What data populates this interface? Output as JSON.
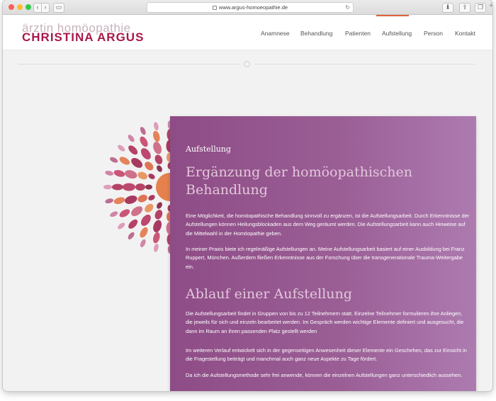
{
  "browser": {
    "url": "www.argus-homoeopathie.de",
    "new_tab_label": "+"
  },
  "logo": {
    "line1": "ärztin homöopathie",
    "line2": "CHRISTINA ARGUS",
    "colors": {
      "line1": "#c7b3bd",
      "line2": "#a8184b"
    }
  },
  "nav": {
    "items": [
      "Anamnese",
      "Behandlung",
      "Patienten",
      "Aufstellung",
      "Person",
      "Kontakt"
    ],
    "active": "Aufstellung",
    "active_color": "#e0623a"
  },
  "content": {
    "label": "Aufstellung",
    "title": "Ergänzung der homöopathischen Behandlung",
    "paragraph1": "Eine Möglichkeit, die homöopathische Behandlung sinnvoll zu ergänzen, ist die Aufstellungsarbeit. Durch Erkenntnisse der Aufstellungen können Heilungsblockaden aus dem Weg geräumt werden. Die Aufstellungsarbeit kann auch Hinweise auf die Mittelwahl in der Homöopathie geben.",
    "paragraph2": "In meiner Praxis biete ich regelmäßige Aufstellungen an. Meine Aufstellungsarbeit basiert auf einer Ausbildung bei Franz Ruppert, München. Außerdem fließen Erkenntnisse aus der Forschung über die transgenerationale Trauma-Weitergabe ein.",
    "heading2": "Ablauf einer Aufstellung",
    "paragraph3": "Die Aufstellungsarbeit findet in Gruppen von bis zu 12 Teilnehmern statt. Einzelne Teilnehmer formulieren ihre Anliegen, die jeweils für sich und einzeln bearbeitet werden. Im Gespräch werden wichtige Elemente definiert und ausgesucht, die dann im Raum an ihren passenden Platz gestellt werden",
    "paragraph4": "Im weiteren Verlauf entwickelt sich in der gegenseitigen Anwesenheit dieser Elemente ein Geschehen, das zur Einsicht in die Fragestellung beiträgt und manchmal auch ganz neue Aspekte zu Tage fördert.",
    "paragraph5": "Da ich die Aufstellungsmethode sehr frei anwende, können die einzelnen Aufstellungen ganz unterschiedlich aussehen.",
    "panel_colors": [
      "#8e4c86",
      "#ad7bb0"
    ]
  },
  "icons": {
    "mandala": "watercolor-mandala",
    "lock": "lock-icon",
    "reload": "reload-icon"
  }
}
